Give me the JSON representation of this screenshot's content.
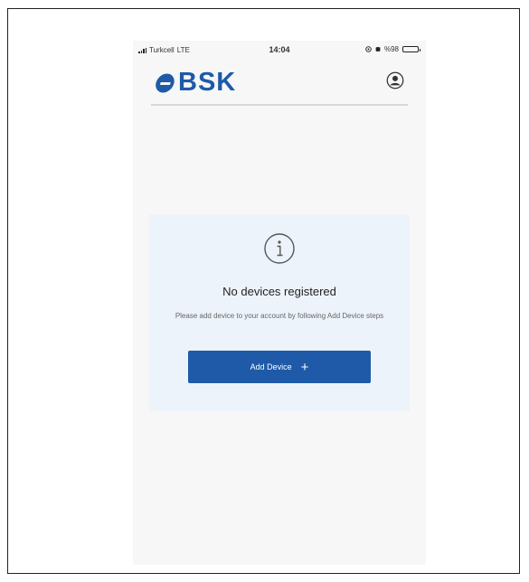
{
  "status_bar": {
    "carrier": "Turkcell",
    "network": "LTE",
    "time": "14:04",
    "battery": "%98"
  },
  "header": {
    "logo_text": "BSK",
    "profile_icon": "user-circle-icon"
  },
  "empty_state": {
    "icon": "info-icon",
    "title": "No devices registered",
    "description": "Please add device to your account by following Add Device steps",
    "button_label": "Add Device",
    "button_icon": "+"
  },
  "colors": {
    "brand": "#1e5aa8",
    "card_background": "#edf3fb",
    "screen_background": "#f7f7f7"
  }
}
